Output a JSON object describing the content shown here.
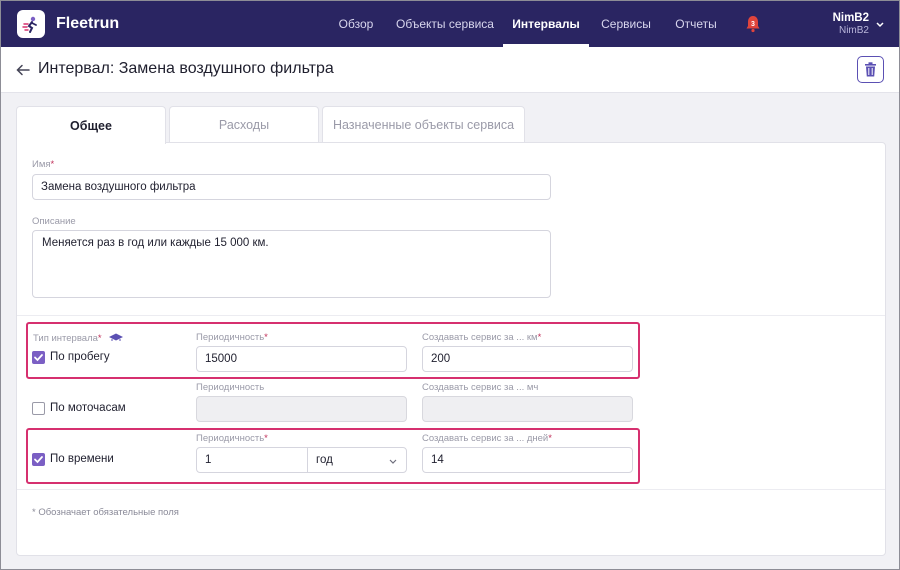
{
  "app": {
    "brand": "Fleetrun",
    "nav": [
      "Обзор",
      "Объекты сервиса",
      "Интервалы",
      "Сервисы",
      "Отчеты"
    ],
    "active_nav": "Интервалы",
    "notifications_count": "3",
    "user_name": "NimB2",
    "user_sub": "NimB2"
  },
  "header": {
    "title": "Интервал: Замена воздушного фильтра"
  },
  "tabs": [
    "Общее",
    "Расходы",
    "Назначенные объекты сервиса"
  ],
  "form": {
    "name_label": "Имя",
    "name_value": "Замена воздушного фильтра",
    "description_label": "Описание",
    "description_value": "Меняется раз в год или каждые 15 000 км.",
    "interval_type_label": "Тип интервала",
    "mileage": {
      "checkbox_label": "По пробегу",
      "checked": true,
      "period_label": "Периодичность",
      "period_value": "15000",
      "create_label": "Создавать сервис за ... км",
      "create_value": "200"
    },
    "engine_hours": {
      "checkbox_label": "По моточасам",
      "checked": false,
      "period_label": "Периодичность",
      "period_value": "",
      "create_label": "Создавать сервис за ... мч",
      "create_value": ""
    },
    "time": {
      "checkbox_label": "По времени",
      "checked": true,
      "period_label": "Периодичность",
      "period_value": "1",
      "period_unit": "год",
      "create_label": "Создавать сервис за ... дней",
      "create_value": "14"
    },
    "required_note": "Обозначает обязательные поля"
  },
  "colors": {
    "nav_bg": "#2a2562",
    "accent": "#7b5fc4",
    "highlight": "#d6306f",
    "notification": "#e0443c"
  }
}
